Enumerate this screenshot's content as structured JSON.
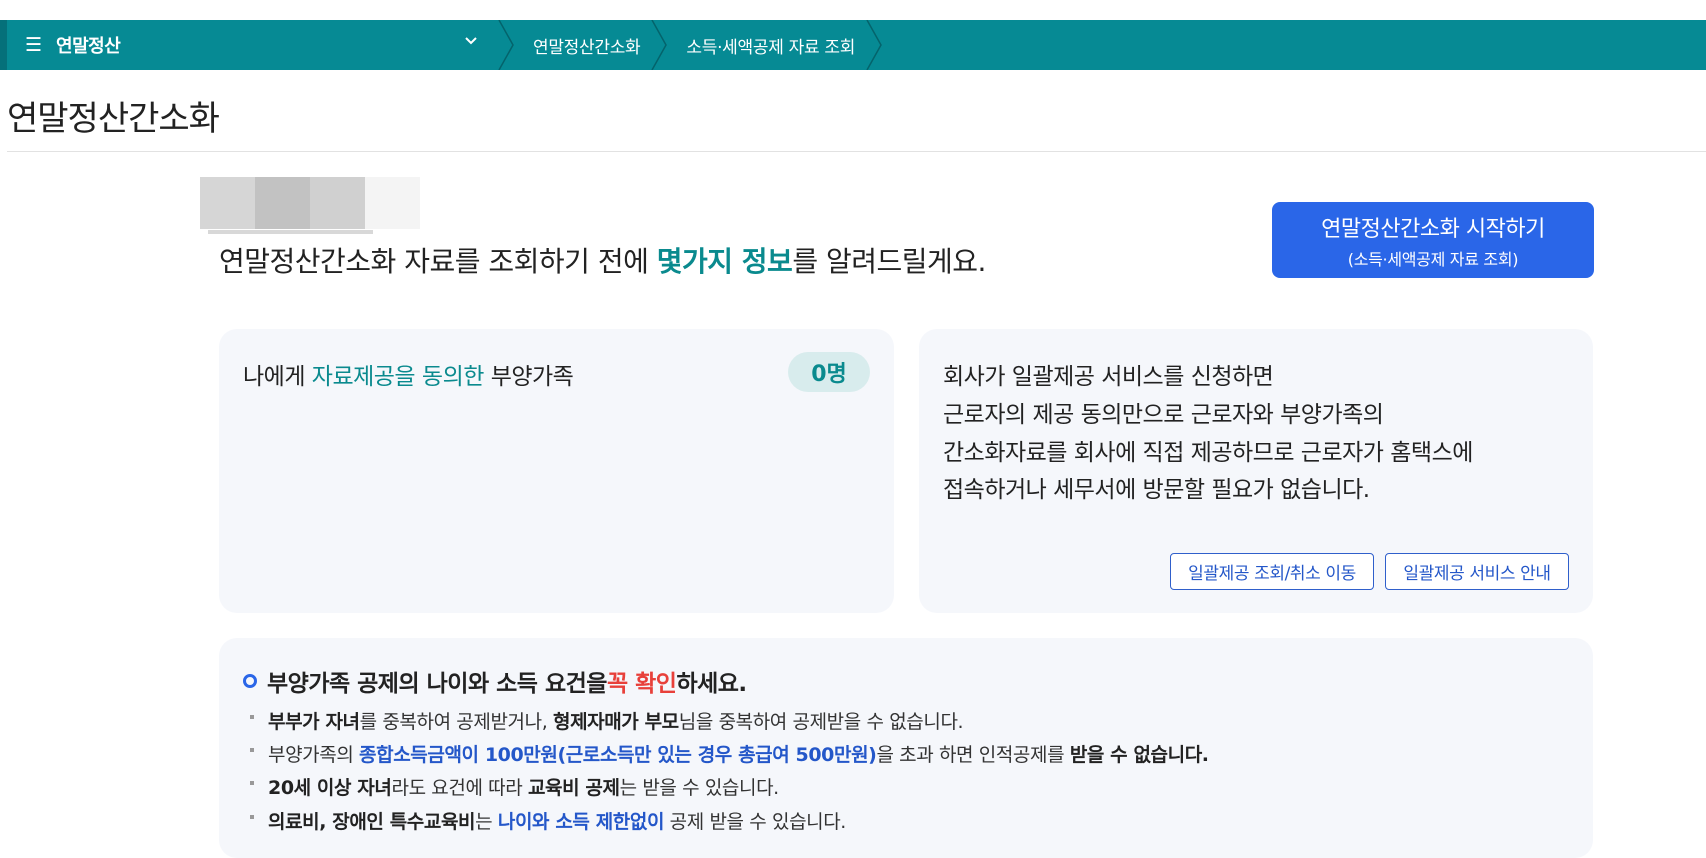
{
  "nav": {
    "menu_title": "연말정산",
    "crumbs": [
      "연말정산간소화",
      "소득·세액공제 자료 조회"
    ]
  },
  "page_title": "연말정산간소화",
  "intro": {
    "before": "연말정산간소화 자료를 조회하기 전에 ",
    "accent": "몇가지 정보",
    "after": "를 알려드릴게요."
  },
  "start_button": {
    "main": "연말정산간소화 시작하기",
    "sub": "(소득·세액공제 자료 조회)"
  },
  "consent_card": {
    "prefix": "나에게 ",
    "accent": "자료제공을 동의한",
    "suffix": " 부양가족",
    "count": "0명"
  },
  "info_card": {
    "lines": [
      "회사가 일괄제공 서비스를 신청하면",
      "근로자의 제공 동의만으로 근로자와 부양가족의",
      "간소화자료를 회사에 직접 제공하므로 근로자가 홈택스에",
      "접속하거나 세무서에 방문할 필요가 없습니다."
    ],
    "buttons": [
      "일괄제공 조회/취소 이동",
      "일괄제공 서비스 안내"
    ]
  },
  "notice": {
    "head_before": "부양가족 공제의 나이와 소득 요건을 ",
    "head_red": "꼭 확인",
    "head_after": "하세요.",
    "b1": {
      "p1": "부부가 자녀",
      "p2": "를 중복하여 공제받거나, ",
      "p3": "형제자매가 부모",
      "p4": "님을 중복하여 공제받을 수 없습니다."
    },
    "b2": {
      "p1": "부양가족의 ",
      "p2": "종합소득금액이 100만원(근로소득만 있는 경우 총급여 500만원)",
      "p3": "을 초과 하면 인적공제를 ",
      "p4": "받을 수 없습니다."
    },
    "b3": {
      "p1": "20세 이상 자녀",
      "p2": "라도 요건에 따라 ",
      "p3": "교육비 공제",
      "p4": "는 받을 수 있습니다."
    },
    "b4": {
      "p1": "의료비, 장애인 특수교육비",
      "p2": "는 ",
      "p3": "나이와 소득 제한없이",
      "p4": " 공제 받을 수 있습니다."
    }
  },
  "colors": {
    "nav_bg": "#068a94",
    "accent_teal": "#0a8a8e",
    "primary_blue": "#2a66e8",
    "warn_red": "#e8403a"
  }
}
